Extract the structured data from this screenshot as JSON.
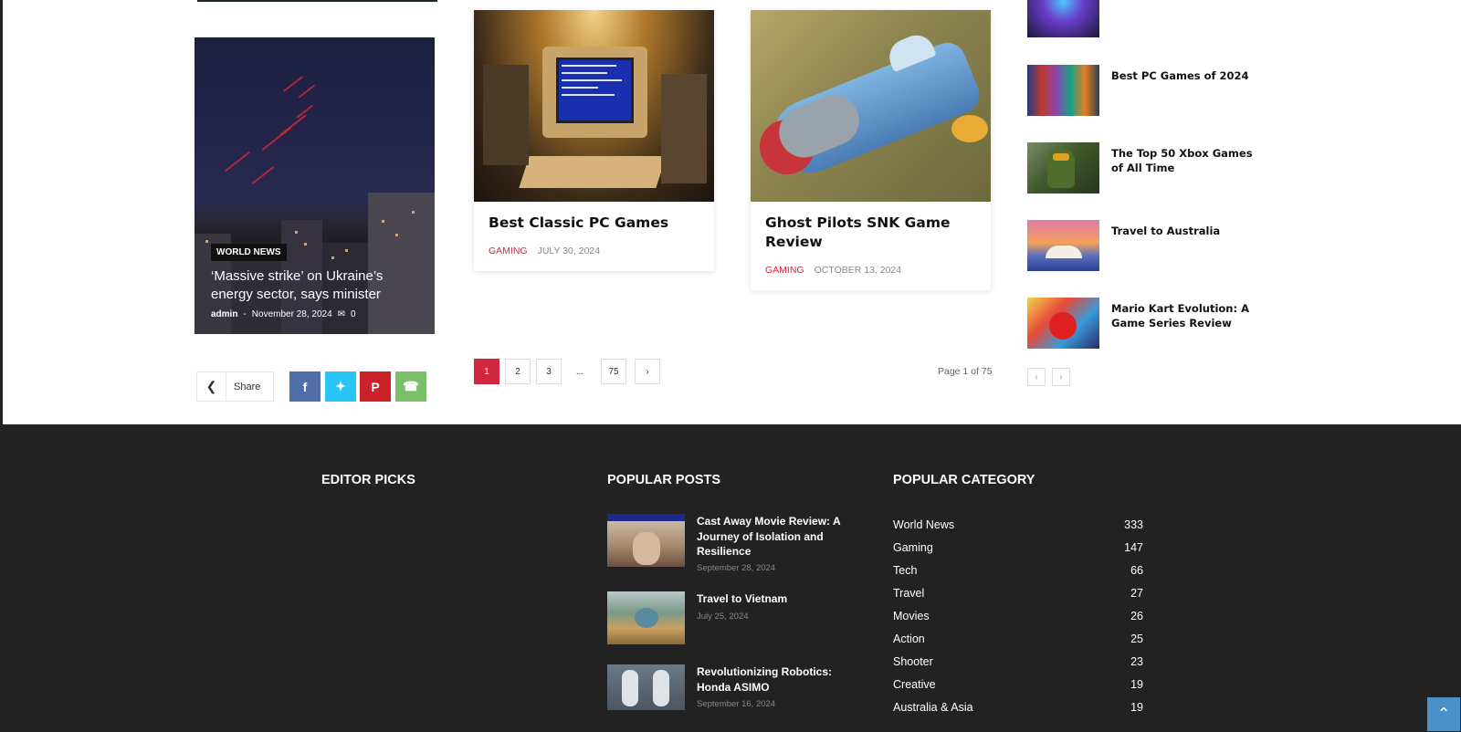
{
  "world_news_card": {
    "tag": "WORLD NEWS",
    "title": "‘Massive strike’ on Ukraine’s energy sector, says minister",
    "author": "admin",
    "separator": "-",
    "date": "November 28, 2024",
    "comments": "0"
  },
  "share": {
    "label": "Share"
  },
  "posts": [
    {
      "title": "Best Classic PC Games",
      "category": "GAMING",
      "date": "JULY 30, 2024"
    },
    {
      "title": "Ghost Pilots SNK Game Review",
      "category": "GAMING",
      "date": "OCTOBER 13, 2024"
    }
  ],
  "pagination": {
    "pages": [
      "1",
      "2",
      "3",
      "...",
      "75"
    ],
    "next": "›",
    "page_of": "Page 1 of 75"
  },
  "sidebar": {
    "items": [
      {
        "title": "Best PC Games of 2024"
      },
      {
        "title": "The Top 50 Xbox Games of All Time"
      },
      {
        "title": "Travel to Australia"
      },
      {
        "title": "Mario Kart Evolution: A Game Series Review"
      }
    ],
    "prev": "‹",
    "next": "›"
  },
  "footer": {
    "editor_picks": "EDITOR PICKS",
    "popular_posts": "POPULAR POSTS",
    "popular_category": "POPULAR CATEGORY",
    "posts": [
      {
        "title": "Cast Away Movie Review: A Journey of Isolation and Resilience",
        "date": "September 28, 2024"
      },
      {
        "title": "Travel to Vietnam",
        "date": "July 25, 2024"
      },
      {
        "title": "Revolutionizing Robotics: Honda ASIMO",
        "date": "September 16, 2024"
      }
    ],
    "categories": [
      {
        "name": "World News",
        "count": "333"
      },
      {
        "name": "Gaming",
        "count": "147"
      },
      {
        "name": "Tech",
        "count": "66"
      },
      {
        "name": "Travel",
        "count": "27"
      },
      {
        "name": "Movies",
        "count": "26"
      },
      {
        "name": "Action",
        "count": "25"
      },
      {
        "name": "Shooter",
        "count": "23"
      },
      {
        "name": "Creative",
        "count": "19"
      },
      {
        "name": "Australia & Asia",
        "count": "19"
      }
    ]
  },
  "colors": {
    "accent": "#d1283f",
    "footer_bg": "#222222",
    "facebook": "#516eab",
    "twitter": "#29c5f6",
    "pinterest": "#ca212a",
    "whatsapp": "#7bbf6a",
    "back_to_top": "#4a90c9"
  },
  "icons": {
    "share": "share-icon",
    "comments": "comment-icon",
    "back_to_top": "arrow-up-icon"
  }
}
